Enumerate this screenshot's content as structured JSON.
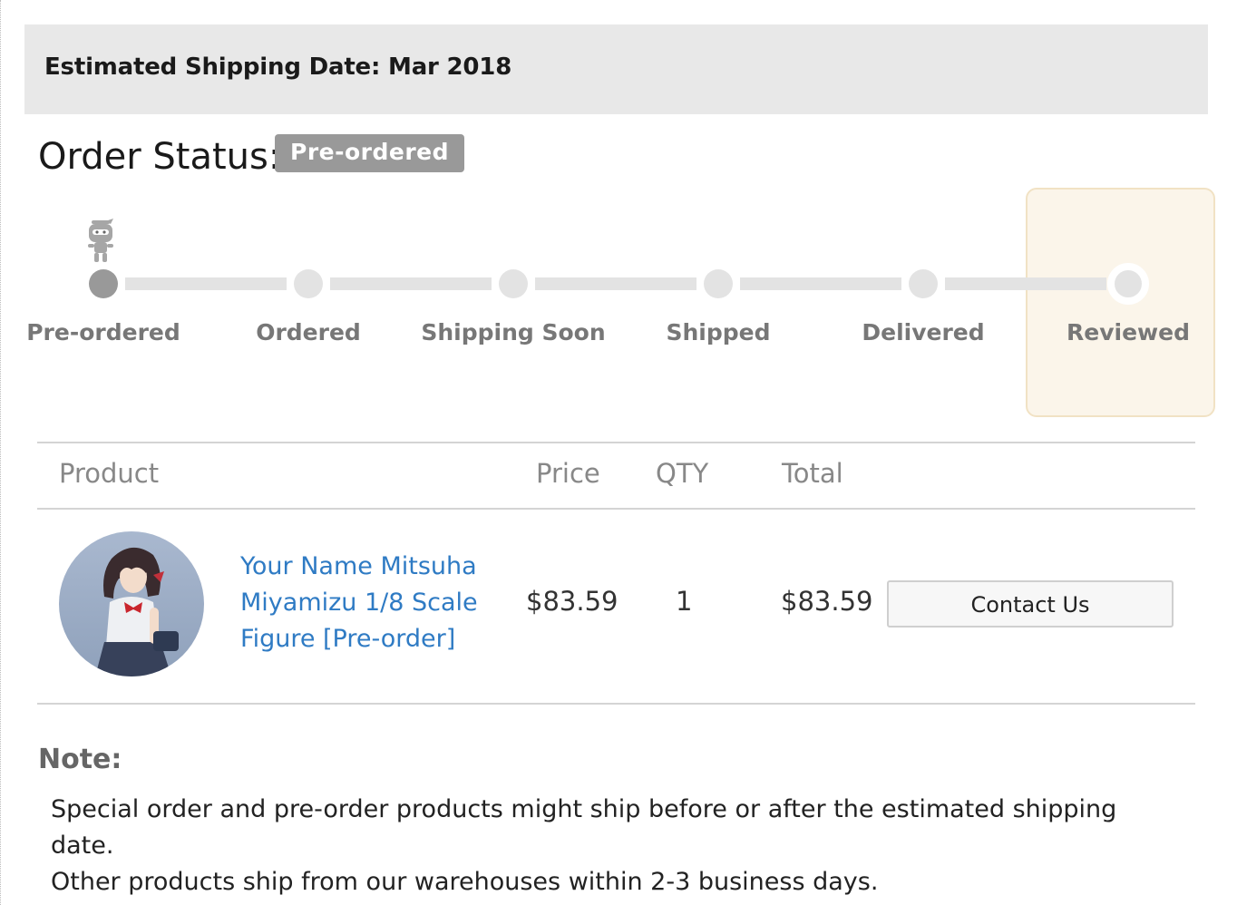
{
  "banner": {
    "estimated_shipping": "Estimated Shipping Date: Mar 2018"
  },
  "order_status": {
    "label": "Order Status:",
    "badge": "Pre-ordered"
  },
  "progress": {
    "current_step": 1,
    "steps": [
      {
        "label": "Pre-ordered"
      },
      {
        "label": "Ordered"
      },
      {
        "label": "Shipping Soon"
      },
      {
        "label": "Shipped"
      },
      {
        "label": "Delivered"
      },
      {
        "label": "Reviewed"
      }
    ]
  },
  "table": {
    "headers": {
      "product": "Product",
      "price": "Price",
      "qty": "QTY",
      "total": "Total"
    },
    "rows": [
      {
        "product_name": "Your Name Mitsuha Miyamizu 1/8 Scale Figure [Pre-order]",
        "price": "$83.59",
        "qty": "1",
        "total": "$83.59",
        "action_label": "Contact Us"
      }
    ]
  },
  "note": {
    "title": "Note:",
    "line1": "Special order and pre-order products might ship before or after the estimated shipping date.",
    "line2": "Other products ship from our warehouses within 2-3 business days."
  },
  "colors": {
    "badge": "#999999",
    "link": "#2f7bc4",
    "banner_bg": "#e8e8e8",
    "highlight_bg": "#fbf5ea"
  }
}
